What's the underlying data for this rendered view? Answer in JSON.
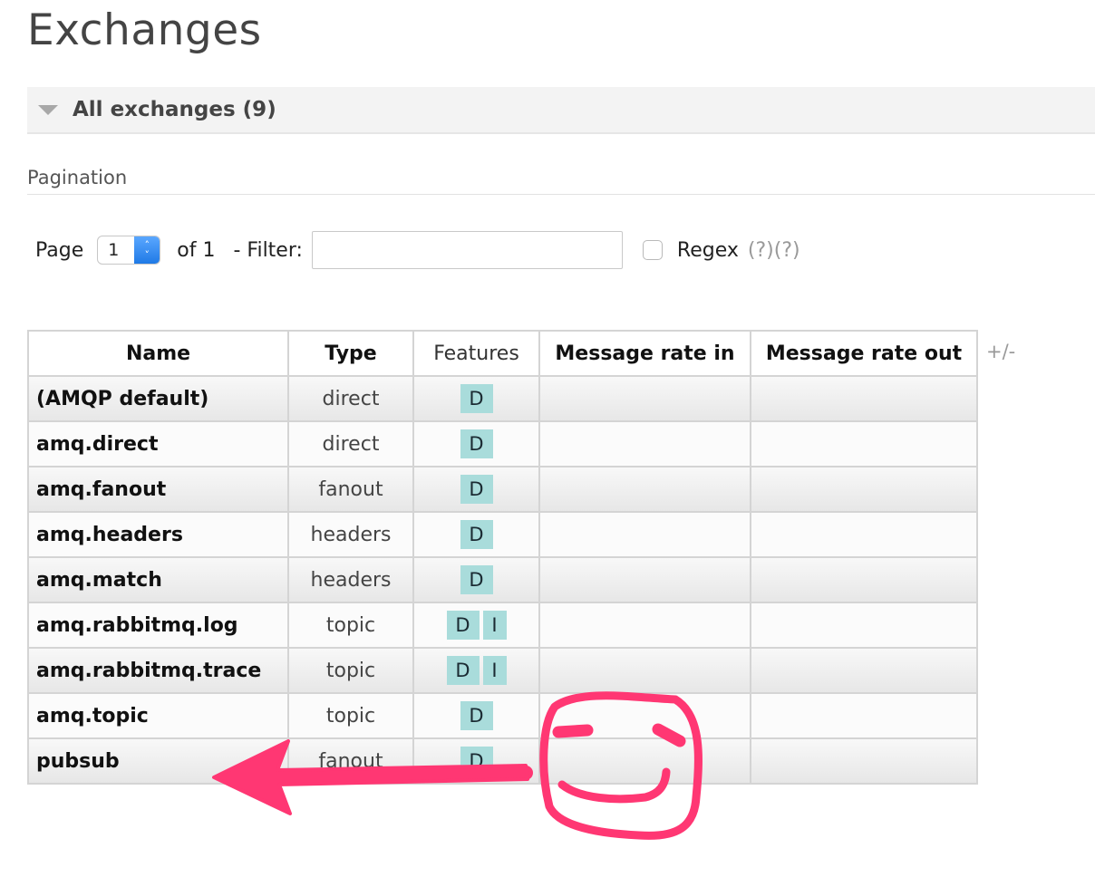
{
  "page_title": "Exchanges",
  "section": {
    "label": "All exchanges (9)"
  },
  "pagination": {
    "title": "Pagination",
    "page_label": "Page",
    "page_value": "1",
    "of_label": "of 1",
    "filter_label": "- Filter:",
    "filter_value": "",
    "regex_label": "Regex",
    "help_links": "(?)(?)"
  },
  "table": {
    "headers": {
      "name": "Name",
      "type": "Type",
      "features": "Features",
      "rate_in": "Message rate in",
      "rate_out": "Message rate out"
    },
    "toggle_columns": "+/-",
    "rows": [
      {
        "name": "(AMQP default)",
        "type": "direct",
        "features": [
          "D"
        ],
        "rate_in": "",
        "rate_out": ""
      },
      {
        "name": "amq.direct",
        "type": "direct",
        "features": [
          "D"
        ],
        "rate_in": "",
        "rate_out": ""
      },
      {
        "name": "amq.fanout",
        "type": "fanout",
        "features": [
          "D"
        ],
        "rate_in": "",
        "rate_out": ""
      },
      {
        "name": "amq.headers",
        "type": "headers",
        "features": [
          "D"
        ],
        "rate_in": "",
        "rate_out": ""
      },
      {
        "name": "amq.match",
        "type": "headers",
        "features": [
          "D"
        ],
        "rate_in": "",
        "rate_out": ""
      },
      {
        "name": "amq.rabbitmq.log",
        "type": "topic",
        "features": [
          "D",
          "I"
        ],
        "rate_in": "",
        "rate_out": ""
      },
      {
        "name": "amq.rabbitmq.trace",
        "type": "topic",
        "features": [
          "D",
          "I"
        ],
        "rate_in": "",
        "rate_out": ""
      },
      {
        "name": "amq.topic",
        "type": "topic",
        "features": [
          "D"
        ],
        "rate_in": "",
        "rate_out": ""
      },
      {
        "name": "pubsub",
        "type": "fanout",
        "features": [
          "D"
        ],
        "rate_in": "",
        "rate_out": ""
      }
    ]
  },
  "annotation_colors": {
    "ink": "#ff3773"
  }
}
